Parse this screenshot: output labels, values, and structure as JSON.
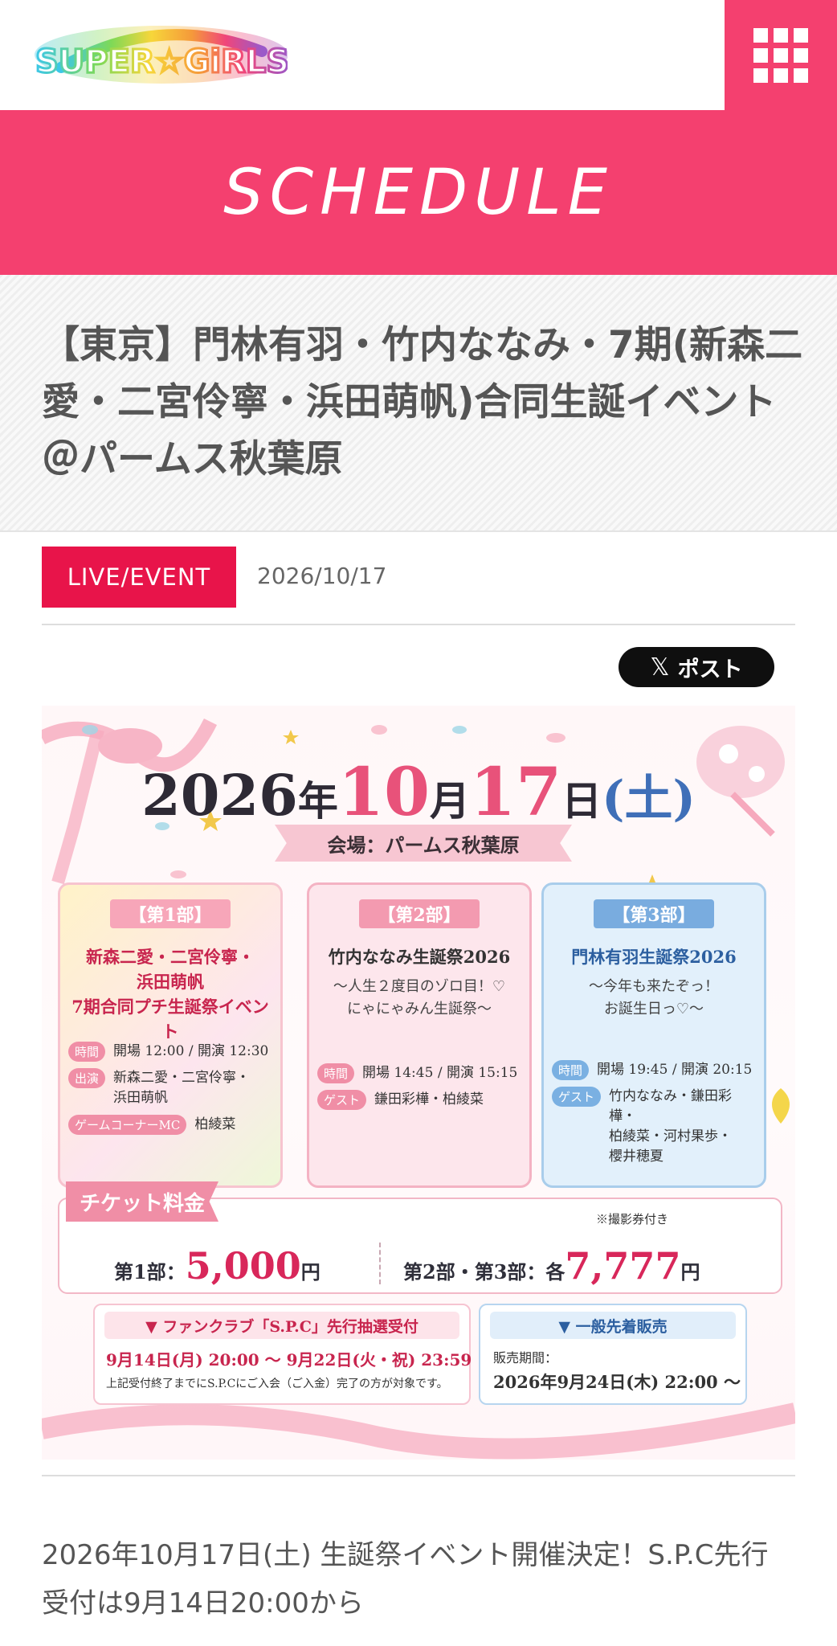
{
  "header": {
    "logo_text": "SUPER☆GiRLS",
    "menu_icon": "grid-menu-icon"
  },
  "banner": {
    "title": "SCHEDULE"
  },
  "article": {
    "title": "【東京】門林有羽・竹内ななみ・7期(新森二愛・二宮伶寧・浜田萌帆)合同生誕イベント＠パームス秋葉原",
    "category": "LIVE/EVENT",
    "date": "2026/10/17",
    "share_button": "ポスト",
    "share_icon": "x-logo-icon",
    "body": "2026年10月17日(土) 生誕祭イベント開催決定！S.P.C先行受付は9月14日20:00から"
  },
  "flyer": {
    "date_year": "2026",
    "date_nen": "年",
    "date_month": "10",
    "date_gatsu": "月",
    "date_day": "17",
    "date_nichi": "日",
    "date_weekday": "(土)",
    "venue": "会場：パームス秋葉原",
    "parts": [
      {
        "label": "【第1部】",
        "title": "新森二愛・二宮伶寧・\n浜田萌帆\n7期合同プチ生誕祭イベント",
        "subtitle": "",
        "time_tag": "時間",
        "time": "開場 12:00 / 開演 12:30",
        "cast_tag": "出演",
        "cast": "新森二愛・二宮伶寧・\n浜田萌帆",
        "mc_tag": "ゲームコーナーMC",
        "mc": "柏綾菜"
      },
      {
        "label": "【第2部】",
        "title": "竹内ななみ生誕祭2026",
        "subtitle": "～人生２度目のゾロ目！♡\nにゃにゃみん生誕祭～",
        "time_tag": "時間",
        "time": "開場 14:45 / 開演 15:15",
        "guest_tag": "ゲスト",
        "guest": "鎌田彩樺・柏綾菜"
      },
      {
        "label": "【第3部】",
        "title": "門林有羽生誕祭2026",
        "subtitle": "～今年も来たぞっ！\nお誕生日っ♡～",
        "time_tag": "時間",
        "time": "開場 19:45 / 開演 20:15",
        "guest_tag": "ゲスト",
        "guest": "竹内ななみ・鎌田彩樺・\n柏綾菜・河村果歩・\n櫻井穂夏"
      }
    ],
    "ticket": {
      "heading": "チケット料金",
      "note": "※撮影券付き",
      "part1_label": "第1部：",
      "part1_price": "5,000",
      "part1_unit": "円",
      "part23_label": "第2部・第3部：各",
      "part23_price": "7,777",
      "part23_unit": "円"
    },
    "sales": {
      "fc_heading": "▼ ファンクラブ「S.P.C」先行抽選受付",
      "fc_period": "9月14日(月) 20:00 ～ 9月22日(火・祝) 23:59",
      "fc_note": "上記受付終了までにS.P.Cにご入会（ご入金）完了の方が対象です。",
      "general_heading": "▼ 一般先着販売",
      "general_label": "販売期間：",
      "general_period": "2026年9月24日(木) 22:00 ～"
    }
  },
  "colors": {
    "brand_pink": "#f4406f",
    "category_red": "#e8144a",
    "text_gray": "#555555"
  }
}
